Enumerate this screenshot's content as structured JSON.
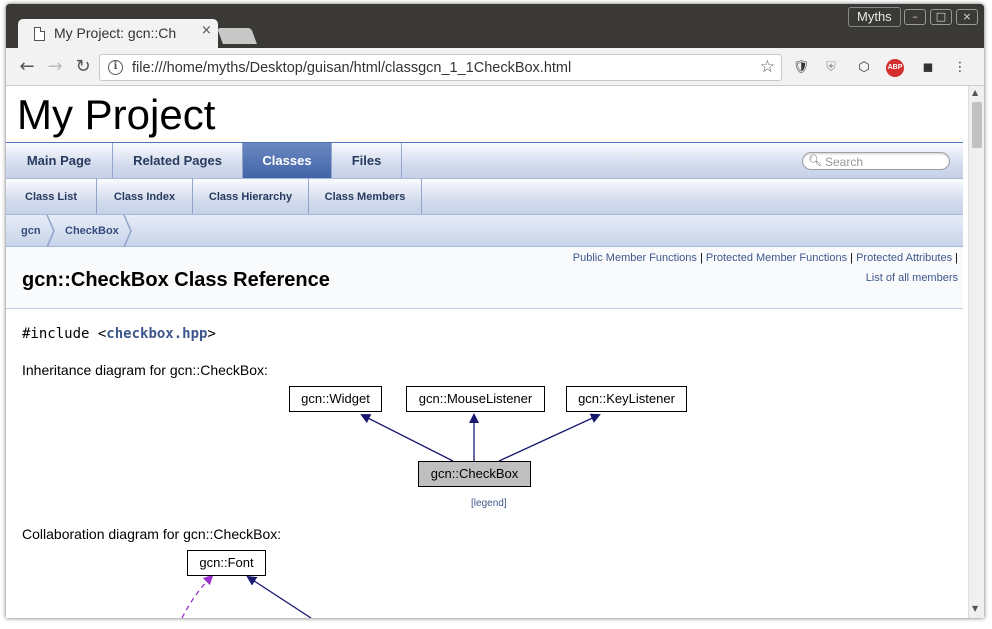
{
  "browser": {
    "tab_title": "My Project: gcn::Ch",
    "tab_close": "×",
    "user_name": "Myths",
    "win_minimize": "–",
    "win_maximize": "□",
    "win_close": "×",
    "url": "file:///home/myths/Desktop/guisan/html/classgcn_1_1CheckBox.html",
    "info_icon": "i",
    "star_icon": "☆",
    "extensions": [
      "shield-icon",
      "ublock-icon",
      "cube-icon",
      "abp-icon",
      "mask-icon",
      "menu-icon"
    ],
    "abp_label": "ABP"
  },
  "page": {
    "project_title": "My Project",
    "main_tabs": [
      {
        "label": "Main Page"
      },
      {
        "label": "Related Pages"
      },
      {
        "label": "Classes"
      },
      {
        "label": "Files"
      }
    ],
    "sub_tabs": [
      {
        "label": "Class List"
      },
      {
        "label": "Class Index"
      },
      {
        "label": "Class Hierarchy"
      },
      {
        "label": "Class Members"
      }
    ],
    "search_placeholder": "Search",
    "breadcrumbs": [
      "gcn",
      "CheckBox"
    ],
    "summary_links": [
      "Public Member Functions",
      "Protected Member Functions",
      "Protected Attributes"
    ],
    "separator": "|",
    "all_members_link": "List of all members",
    "class_title": "gcn::CheckBox Class Reference",
    "include_prefix": "#include <",
    "include_file": "checkbox.hpp",
    "include_suffix": ">",
    "inheritance_label": "Inheritance diagram for gcn::CheckBox:",
    "inheritance_nodes": {
      "widget": "gcn::Widget",
      "mouse": "gcn::MouseListener",
      "key": "gcn::KeyListener",
      "checkbox": "gcn::CheckBox"
    },
    "legend_link": "legend",
    "collaboration_label": "Collaboration diagram for gcn::CheckBox:",
    "collab_node_font": "gcn::Font"
  }
}
